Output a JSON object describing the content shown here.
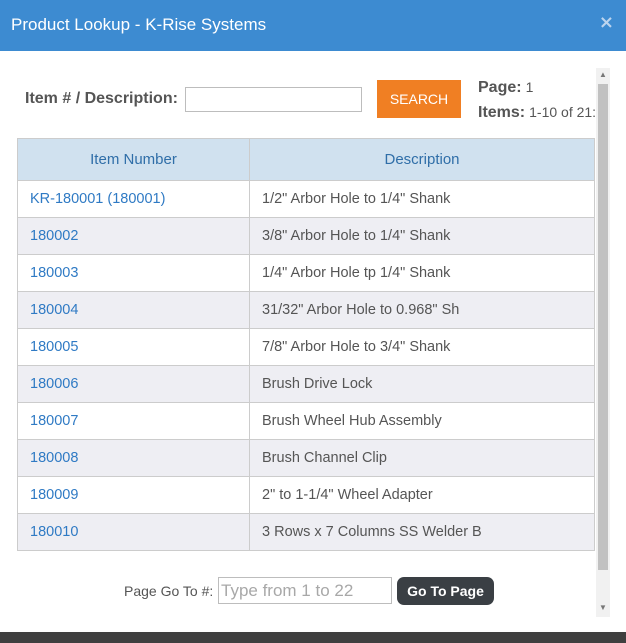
{
  "dialog": {
    "title": "Product Lookup - K-Rise Systems",
    "close_glyph": "×",
    "close_icon": "close-icon"
  },
  "search": {
    "label": "Item # / Description:",
    "value": "",
    "placeholder": "",
    "button_label": "SEARCH"
  },
  "paging": {
    "page_label": "Page:",
    "page_value": "1",
    "items_label": "Items:",
    "items_value": "1-10 of 21:"
  },
  "table": {
    "headers": {
      "item_number": "Item Number",
      "description": "Description"
    },
    "rows": [
      {
        "item": "KR-180001 (180001)",
        "description": "1/2\" Arbor Hole to 1/4\" Shank"
      },
      {
        "item": "180002",
        "description": "3/8\" Arbor Hole to 1/4\" Shank"
      },
      {
        "item": "180003",
        "description": "1/4\" Arbor Hole tp 1/4\" Shank"
      },
      {
        "item": "180004",
        "description": "31/32\" Arbor Hole to 0.968\" Sh"
      },
      {
        "item": "180005",
        "description": "7/8\" Arbor Hole to 3/4\" Shank"
      },
      {
        "item": "180006",
        "description": "Brush Drive Lock"
      },
      {
        "item": "180007",
        "description": "Brush Wheel Hub Assembly"
      },
      {
        "item": "180008",
        "description": "Brush Channel Clip"
      },
      {
        "item": "180009",
        "description": "2\" to 1-1/4\" Wheel Adapter"
      },
      {
        "item": "180010",
        "description": "3 Rows x 7 Columns SS Welder B"
      }
    ]
  },
  "goto": {
    "label": "Page Go To #:",
    "placeholder": "Type from 1 to 22",
    "button_label": "Go To Page"
  },
  "colors": {
    "header_bg": "#3d8bd1",
    "search_button": "#f07f23",
    "table_header_bg": "#d0e1ef",
    "link": "#2f7ac4",
    "goto_button": "#3a3f44"
  }
}
